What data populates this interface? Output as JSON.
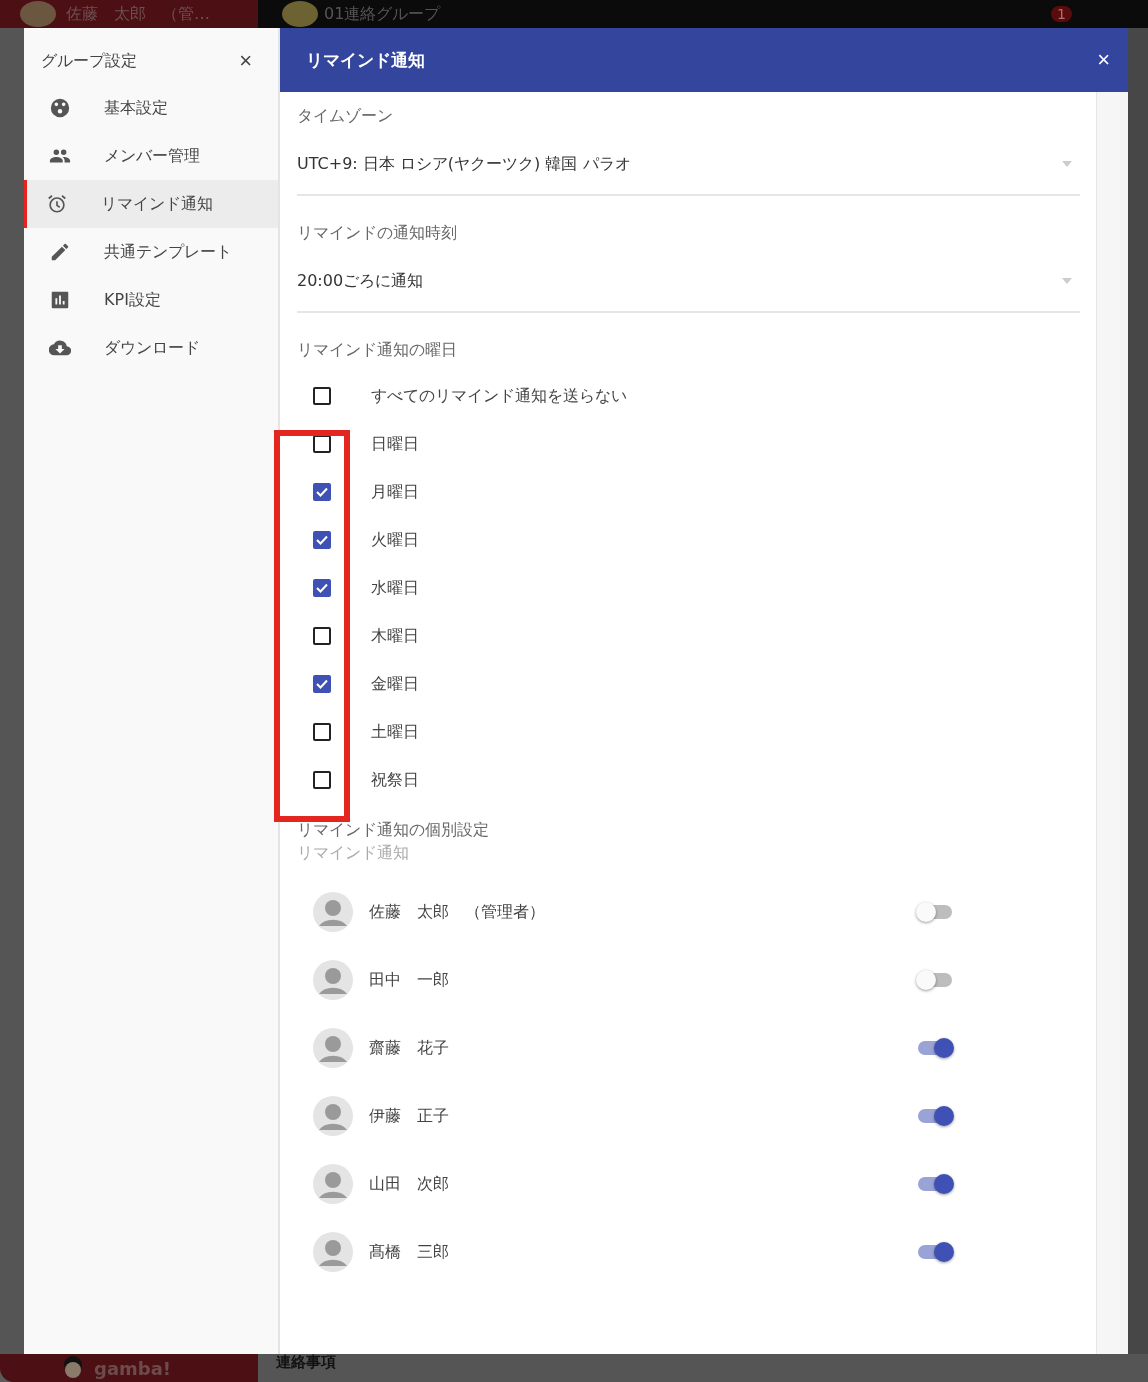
{
  "background_app": {
    "user_name": "佐藤　太郎　（管…",
    "group_name": "01連絡グループ",
    "notification_badge": "1",
    "logo_text": "gamba!",
    "section_title": "連絡事項"
  },
  "sidebar": {
    "title": "グループ設定",
    "close": "×",
    "items": [
      {
        "label": "基本設定",
        "selected": false
      },
      {
        "label": "メンバー管理",
        "selected": false
      },
      {
        "label": "リマインド通知",
        "selected": true
      },
      {
        "label": "共通テンプレート",
        "selected": false
      },
      {
        "label": "KPI設定",
        "selected": false
      },
      {
        "label": "ダウンロード",
        "selected": false
      }
    ]
  },
  "dialog": {
    "title": "リマインド通知",
    "close": "×"
  },
  "timezone": {
    "label": "タイムゾーン",
    "value": "UTC+9: 日本 ロシア(ヤクーツク) 韓国 パラオ"
  },
  "notify_time": {
    "label": "リマインドの通知時刻",
    "value": "20:00ごろに通知"
  },
  "weekdays": {
    "label": "リマインド通知の曜日",
    "items": [
      {
        "label": "すべてのリマインド通知を送らない",
        "checked": false
      },
      {
        "label": "日曜日",
        "checked": false
      },
      {
        "label": "月曜日",
        "checked": true
      },
      {
        "label": "火曜日",
        "checked": true
      },
      {
        "label": "水曜日",
        "checked": true
      },
      {
        "label": "木曜日",
        "checked": false
      },
      {
        "label": "金曜日",
        "checked": true
      },
      {
        "label": "土曜日",
        "checked": false
      },
      {
        "label": "祝祭日",
        "checked": false
      }
    ],
    "annotation": {
      "kind": "rectangle",
      "color": "#e3261f"
    }
  },
  "members": {
    "label": "リマインド通知の個別設定",
    "sublabel": "リマインド通知",
    "items": [
      {
        "name": "佐藤　太郎　（管理者）",
        "on": false
      },
      {
        "name": "田中　一郎",
        "on": false
      },
      {
        "name": "齋藤　花子",
        "on": true
      },
      {
        "name": "伊藤　正子",
        "on": true
      },
      {
        "name": "山田　次郎",
        "on": true
      },
      {
        "name": "髙橋　三郎",
        "on": true
      }
    ]
  }
}
